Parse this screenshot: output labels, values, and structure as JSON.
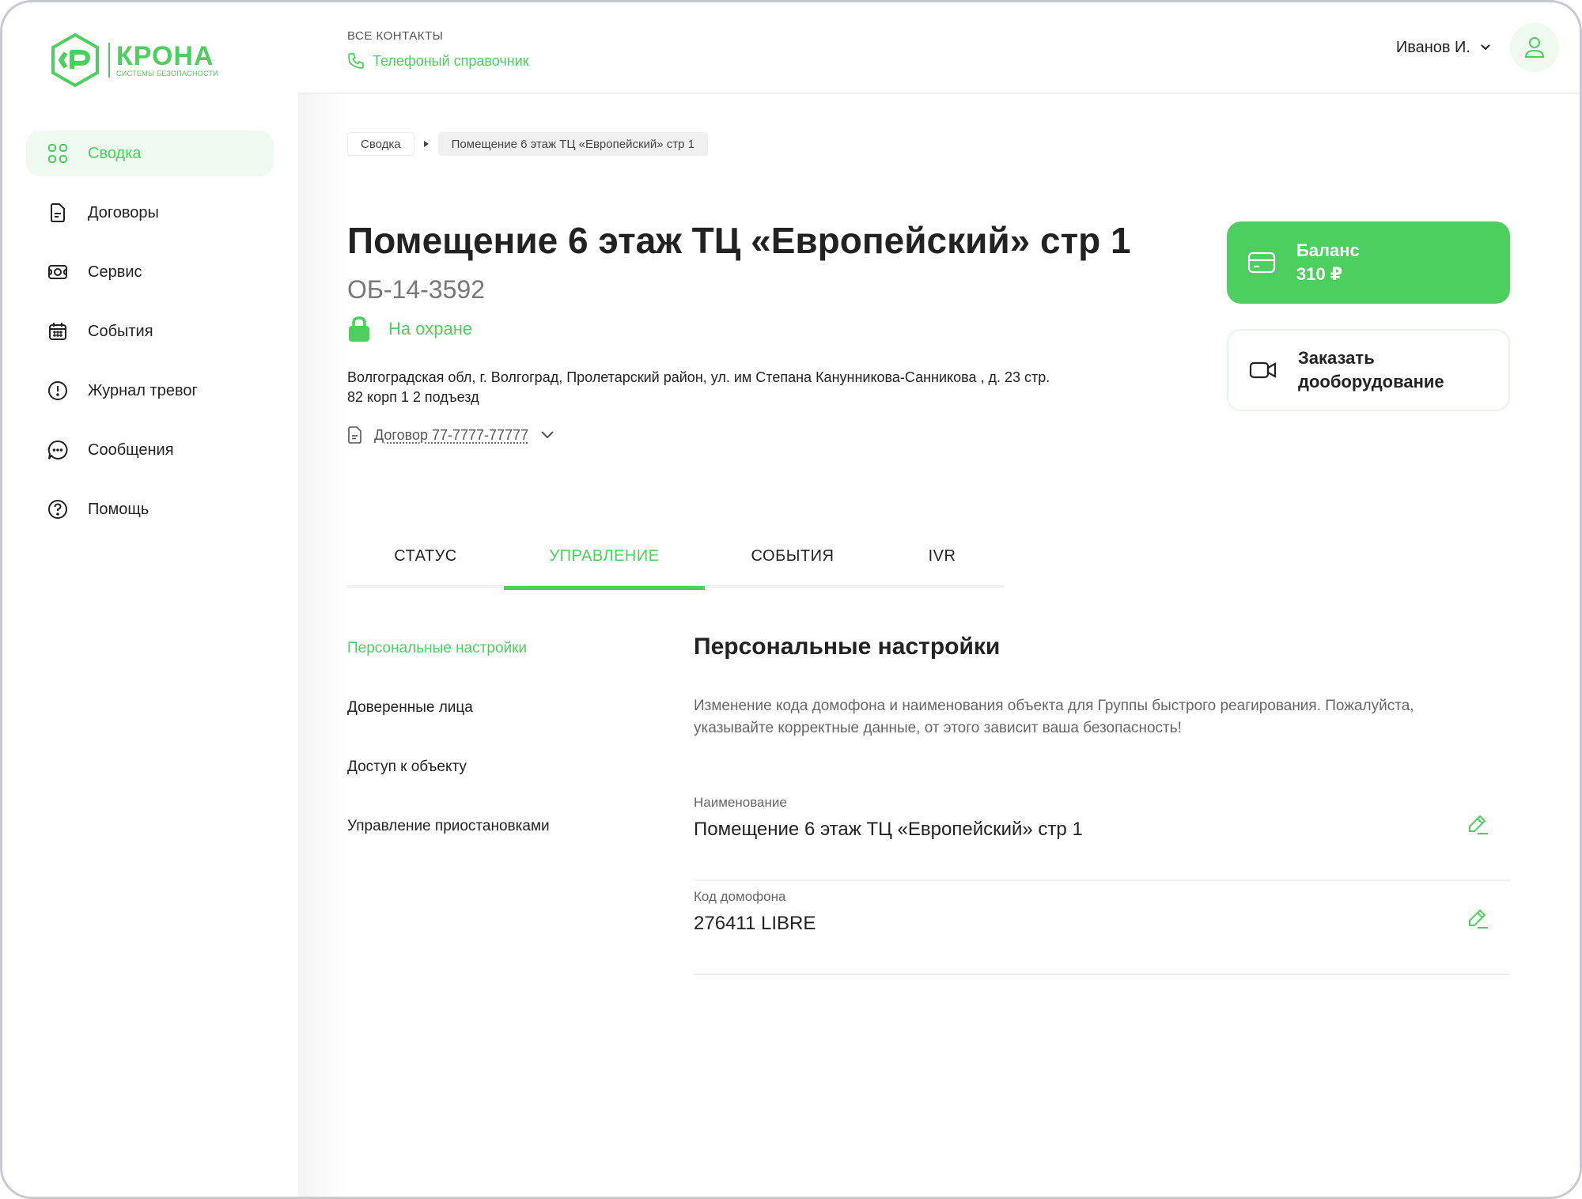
{
  "brand": {
    "name": "КРОНА",
    "subtitle": "СИСТЕМЫ БЕЗОПАСНОСТИ",
    "accent_color": "#4ccf5e"
  },
  "sidebar": {
    "items": [
      {
        "label": "Сводка",
        "icon": "grid-icon",
        "active": true
      },
      {
        "label": "Договоры",
        "icon": "document-icon",
        "active": false
      },
      {
        "label": "Сервис",
        "icon": "service-icon",
        "active": false
      },
      {
        "label": "События",
        "icon": "calendar-icon",
        "active": false
      },
      {
        "label": "Журнал тревог",
        "icon": "alert-icon",
        "active": false
      },
      {
        "label": "Сообщения",
        "icon": "chat-icon",
        "active": false
      },
      {
        "label": "Помощь",
        "icon": "help-icon",
        "active": false
      }
    ]
  },
  "header": {
    "caption": "ВСЕ КОНТАКТЫ",
    "phone_link": "Телефоный справочник",
    "user_name": "Иванов И."
  },
  "breadcrumb": {
    "items": [
      "Сводка",
      "Помещение 6 этаж ТЦ «Европейский» стр 1"
    ]
  },
  "object": {
    "title": "Помещение 6 этаж ТЦ «Европейский» стр 1",
    "code": "ОБ-14-3592",
    "status": "На охране",
    "address": "Волгоградская обл, г. Волгоград, Пролетарский район, ул. им Степана Канунникова-Санникова , д. 23 стр. 82 корп 1 2 подъезд",
    "contract": "Договор 77-7777-77777"
  },
  "balance": {
    "label": "Баланс",
    "value": "310 ₽"
  },
  "order": {
    "label": "Заказать дооборудование"
  },
  "tabs": [
    {
      "label": "СТАТУС",
      "active": false
    },
    {
      "label": "УПРАВЛЕНИЕ",
      "active": true
    },
    {
      "label": "СОБЫТИЯ",
      "active": false
    },
    {
      "label": "IVR",
      "active": false
    }
  ],
  "subnav": [
    {
      "label": "Персональные настройки",
      "active": true
    },
    {
      "label": "Доверенные лица",
      "active": false
    },
    {
      "label": "Доступ к объекту",
      "active": false
    },
    {
      "label": "Управление приостановками",
      "active": false
    }
  ],
  "settings": {
    "title": "Персональные настройки",
    "description": "Изменение кода домофона и наименования объекта для Группы быстрого реагирования. Пожалуйста, указывайте корректные данные, от этого зависит ваша безопасность!",
    "fields": [
      {
        "label": "Наименование",
        "value": "Помещение 6 этаж ТЦ «Европейский» стр 1"
      },
      {
        "label": "Код домофона",
        "value": "276411 LIBRE"
      }
    ]
  }
}
